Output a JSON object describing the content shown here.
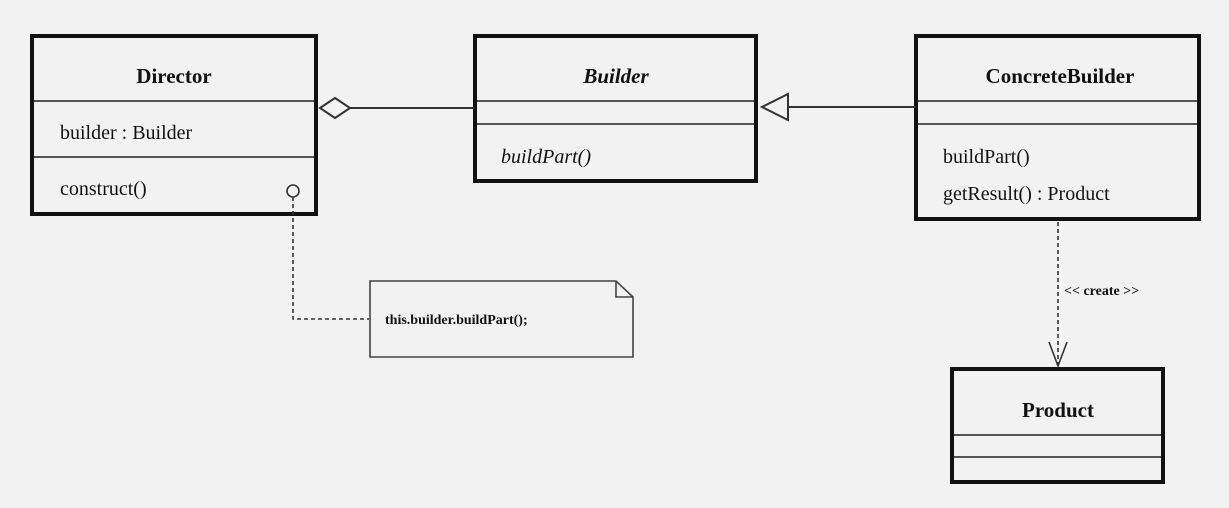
{
  "classes": {
    "director": {
      "name": "Director",
      "attributes": [
        "builder : Builder"
      ],
      "operations": [
        "construct()"
      ]
    },
    "builder": {
      "name": "Builder",
      "abstract": true,
      "attributes": [],
      "operations": [
        "buildPart()"
      ]
    },
    "concrete_builder": {
      "name": "ConcreteBuilder",
      "attributes": [],
      "operations": [
        "buildPart()",
        "getResult() : Product"
      ]
    },
    "product": {
      "name": "Product",
      "attributes": [],
      "operations": []
    }
  },
  "relations": {
    "aggregation": {
      "from": "Director",
      "to": "Builder",
      "type": "aggregation"
    },
    "generalization": {
      "from": "ConcreteBuilder",
      "to": "Builder",
      "type": "generalization"
    },
    "dependency": {
      "from": "ConcreteBuilder",
      "to": "Product",
      "type": "dependency",
      "label": "<< create >>"
    }
  },
  "note": {
    "text": "this.builder.buildPart();",
    "attached_to": "construct()"
  },
  "colors": {
    "background": "#f2f2f2",
    "stroke": "#111111"
  }
}
